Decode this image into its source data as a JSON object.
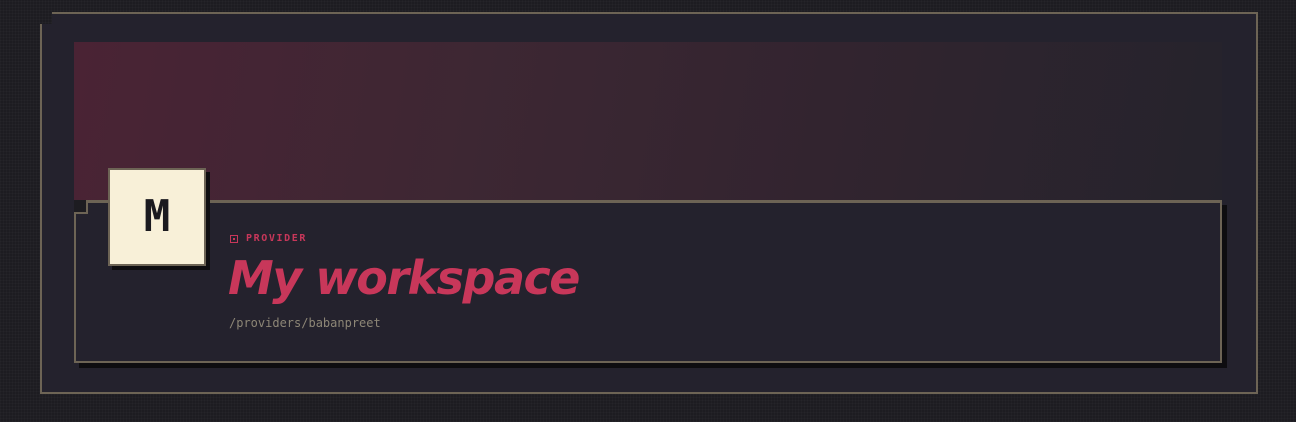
{
  "provider": {
    "avatar_letter": "M",
    "eyebrow_label": "PROVIDER",
    "eyebrow_icon": "square-dot-icon",
    "title": "My workspace",
    "path": "/providers/babanpreet"
  },
  "colors": {
    "accent": "#c8375a",
    "frame_border": "#6d6455",
    "panel_bg": "#24222d",
    "avatar_bg": "#f8f0d8",
    "muted_text": "#8d8676"
  }
}
